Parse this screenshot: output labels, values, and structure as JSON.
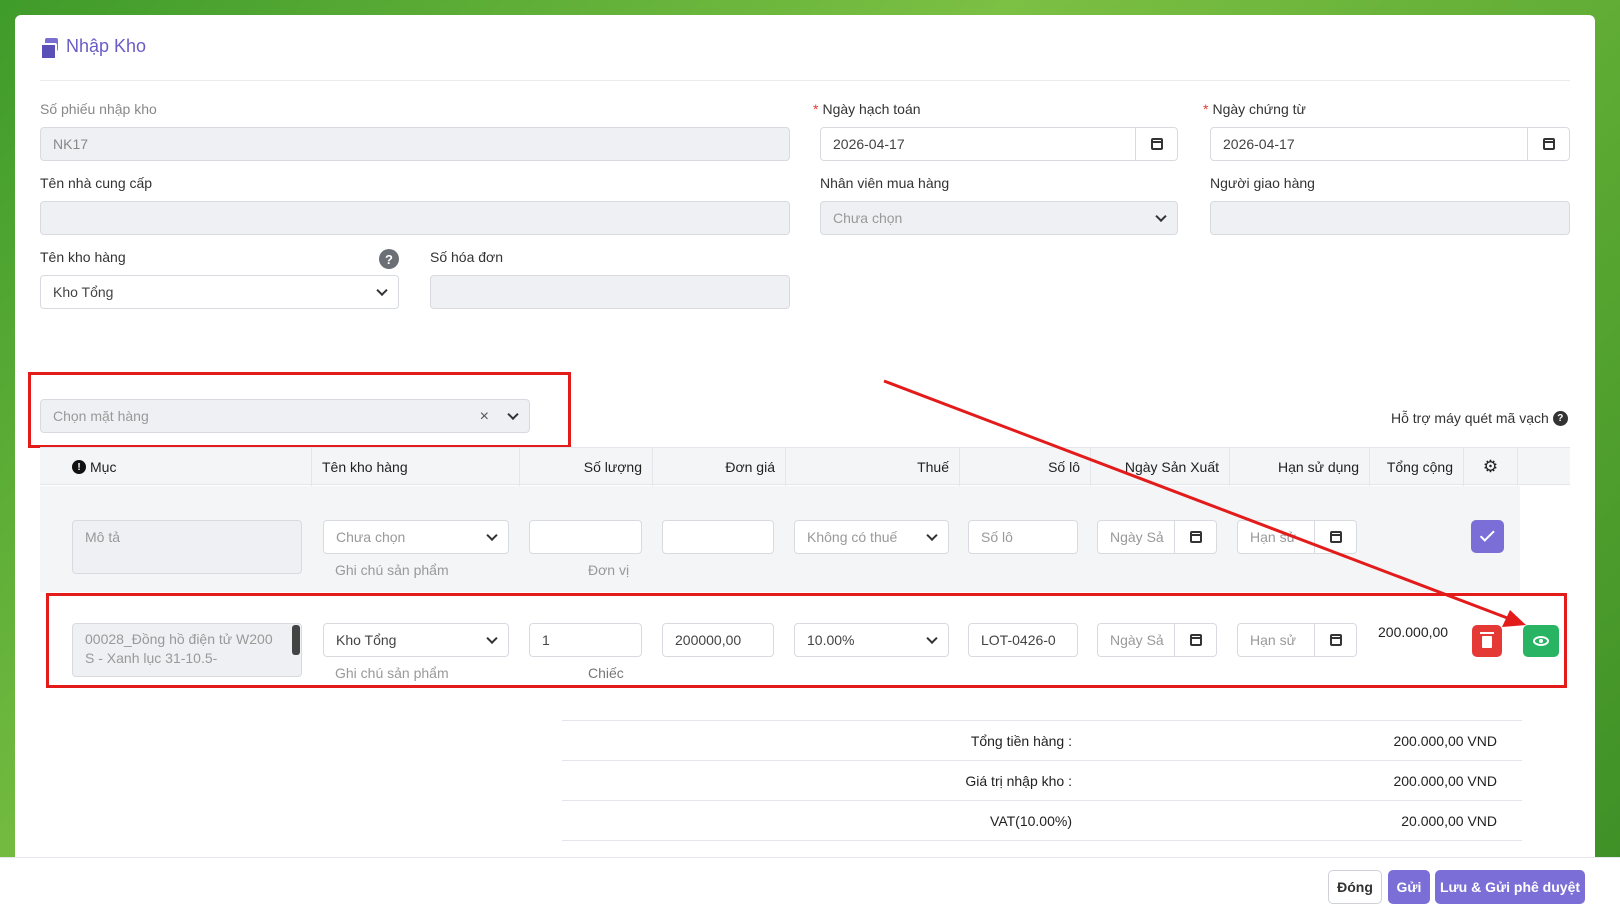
{
  "header": {
    "title": "Nhập Kho"
  },
  "form": {
    "receipt_no": {
      "label": "Số phiếu nhập kho",
      "value": "NK17"
    },
    "posting_date": {
      "label": "Ngày hạch toán",
      "value": "2026-04-17"
    },
    "doc_date": {
      "label": "Ngày chứng từ",
      "value": "2026-04-17"
    },
    "supplier": {
      "label": "Tên nhà cung cấp",
      "value": ""
    },
    "buyer": {
      "label": "Nhân viên mua hàng",
      "placeholder": "Chưa chọn"
    },
    "deliverer": {
      "label": "Người giao hàng",
      "value": ""
    },
    "warehouse": {
      "label": "Tên kho hàng",
      "value": "Kho Tổng",
      "help": "?"
    },
    "invoice_no": {
      "label": "Số hóa đơn",
      "value": ""
    }
  },
  "item_picker": {
    "placeholder": "Chọn mặt hàng",
    "clear": "×",
    "barcode_label": "Hỗ trợ máy quét mã vạch",
    "barcode_help": "?"
  },
  "table": {
    "headers": {
      "item": "Mục",
      "item_icon": "!",
      "warehouse": "Tên kho hàng",
      "qty": "Số lượng",
      "price": "Đơn giá",
      "tax": "Thuế",
      "lot": "Số lô",
      "mfg": "Ngày Sản Xuất",
      "exp": "Hạn sử dụng",
      "total": "Tổng cộng"
    },
    "new_row": {
      "desc_placeholder": "Mô tả",
      "warehouse_placeholder": "Chưa chọn",
      "note_placeholder": "Ghi chú sản phẩm",
      "unit_placeholder": "Đơn vị",
      "tax_value": "Không có thuế",
      "lot_placeholder": "Số lô",
      "mfg_placeholder": "Ngày Sả",
      "exp_placeholder": "Hạn sử"
    },
    "rows": [
      {
        "desc": "00028_Đồng hồ điện tử W200 S - Xanh lục 31-10.5-",
        "warehouse": "Kho Tổng",
        "note_placeholder": "Ghi chú sản phẩm",
        "qty": "1",
        "unit": "Chiếc",
        "price": "200000,00",
        "tax": "10.00%",
        "lot": "LOT-0426-0",
        "mfg_placeholder": "Ngày Sả",
        "exp_placeholder": "Hạn sử",
        "total": "200.000,00"
      }
    ]
  },
  "summary": [
    {
      "label": "Tổng tiền hàng :",
      "value": "200.000,00 VND"
    },
    {
      "label": "Giá trị nhập kho :",
      "value": "200.000,00 VND"
    },
    {
      "label": "VAT(10.00%)",
      "value": "20.000,00 VND"
    }
  ],
  "footer": {
    "close": "Đóng",
    "send": "Gửi",
    "save_send": "Lưu & Gửi phê duyệt"
  },
  "colors": {
    "accent": "#6a5cc7",
    "danger": "#e53935",
    "success": "#28b463",
    "annotation": "#e31b1b"
  }
}
